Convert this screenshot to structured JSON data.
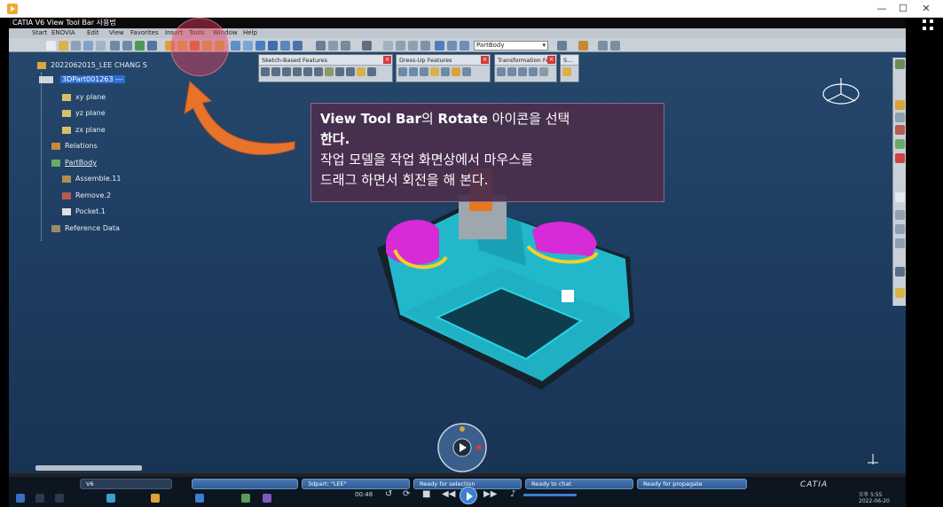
{
  "player": {
    "controls": [
      "—",
      "☐",
      "✕"
    ]
  },
  "catia": {
    "title": "CATIA V6 View Tool Bar 사용법",
    "menu": [
      "Start",
      "ENOVIA",
      "Edit",
      "View",
      "Favorites",
      "Insert",
      "Tools",
      "Window",
      "Help"
    ],
    "workbench": "PartBody"
  },
  "tree": {
    "root": "2022062015_LEE CHANG S",
    "part": "3DPart001263 ---",
    "items": [
      "xy plane",
      "yz plane",
      "zx plane",
      "Relations",
      "PartBody",
      "Assemble.11",
      "Remove.2",
      "Pocket.1",
      "Reference Data"
    ]
  },
  "toolbars": [
    {
      "title": "Sketch-Based Features"
    },
    {
      "title": "Dress-Up Features"
    },
    {
      "title": "Transformation Feat..."
    },
    {
      "title": "S..."
    }
  ],
  "callout": {
    "line1_bold_a": "View Tool Bar",
    "line1_mid": "의 ",
    "line1_bold_b": "Rotate",
    "line1_tail": " 아이콘을 선택",
    "line2": "한다.",
    "line3": "작업 모델을 작업 화면상에서 마우스를",
    "line4": "드래그 하면서 회전을 해 본다."
  },
  "taskbar": {
    "tasks": [
      "V6",
      "",
      "3dpart: \"LEE\"",
      "Ready for selection",
      "Ready to chat",
      "Ready for propagate"
    ],
    "time": "00:48",
    "brand": "CATIA",
    "clock": [
      "오후 5:55",
      "2022-06-20"
    ]
  },
  "colors": {
    "accent": "#e8732a",
    "highlight": "#e63c5a",
    "background": "#1f3e63"
  }
}
